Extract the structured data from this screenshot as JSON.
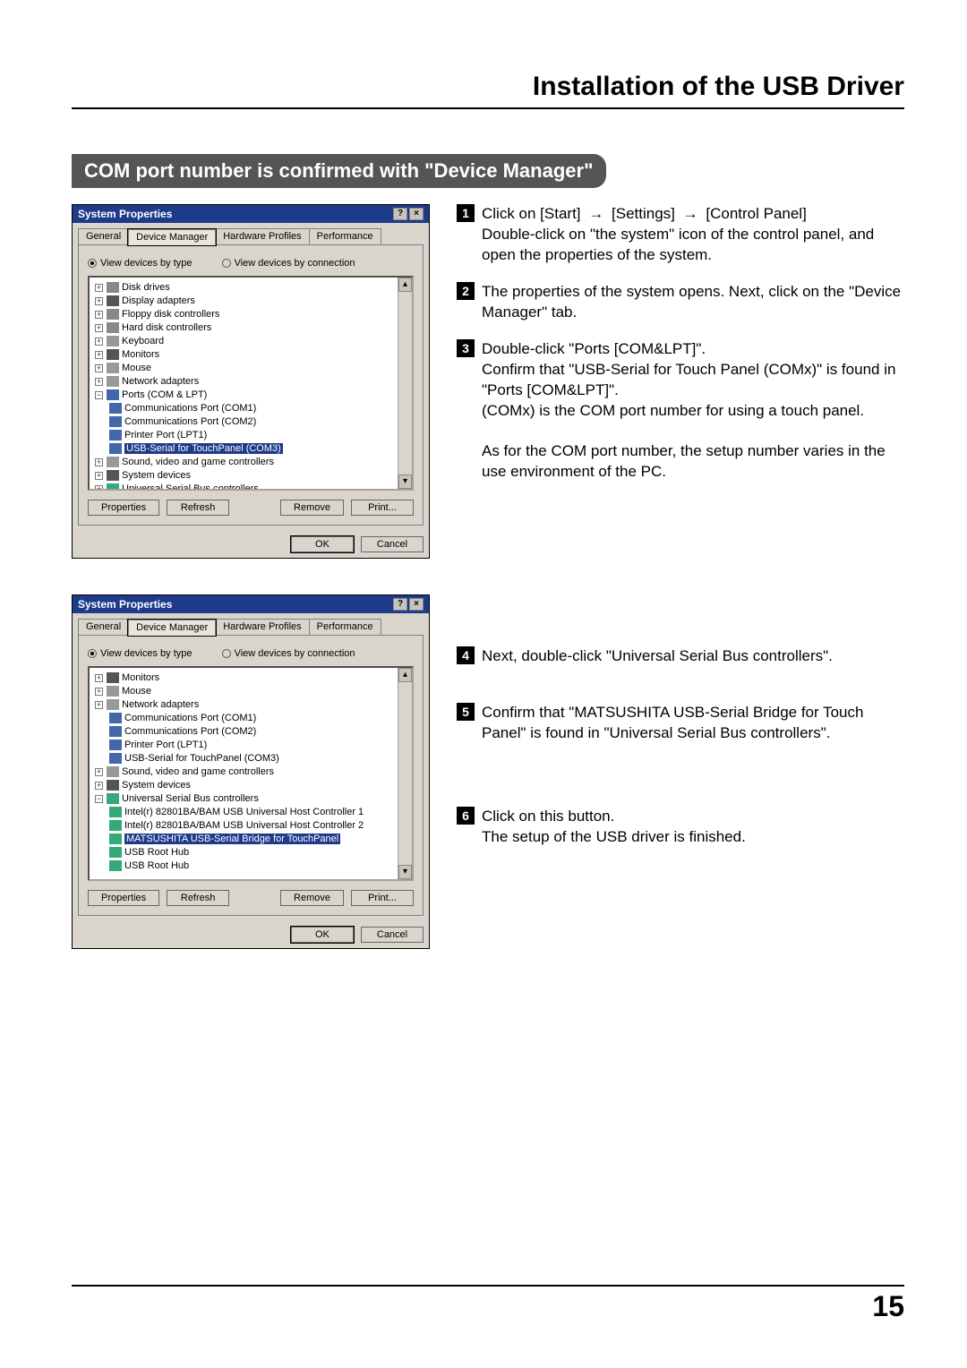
{
  "page_title": "Installation of the USB Driver",
  "page_number": "15",
  "section_banner": "COM port number is confirmed with \"Device Manager\"",
  "dialog1": {
    "title": "System Properties",
    "tabs": [
      "General",
      "Device Manager",
      "Hardware Profiles",
      "Performance"
    ],
    "active_tab": 1,
    "radio_type": "View devices by type",
    "radio_conn": "View devices by connection",
    "tree": {
      "disk": "Disk drives",
      "display": "Display adapters",
      "floppy": "Floppy disk controllers",
      "hdd": "Hard disk controllers",
      "keyboard": "Keyboard",
      "monitors": "Monitors",
      "mouse": "Mouse",
      "network": "Network adapters",
      "ports": "Ports (COM & LPT)",
      "com1": "Communications Port (COM1)",
      "com2": "Communications Port (COM2)",
      "lpt1": "Printer Port (LPT1)",
      "usbserial": "USB-Serial for TouchPanel (COM3)",
      "sound": "Sound, video and game controllers",
      "system": "System devices",
      "usbctl": "Universal Serial Bus controllers"
    },
    "btn_prop": "Properties",
    "btn_refresh": "Refresh",
    "btn_remove": "Remove",
    "btn_print": "Print...",
    "btn_ok": "OK",
    "btn_cancel": "Cancel"
  },
  "dialog2": {
    "title": "System Properties",
    "tabs": [
      "General",
      "Device Manager",
      "Hardware Profiles",
      "Performance"
    ],
    "active_tab": 1,
    "radio_type": "View devices by type",
    "radio_conn": "View devices by connection",
    "tree": {
      "monitors": "Monitors",
      "mouse": "Mouse",
      "network": "Network adapters",
      "com1": "Communications Port (COM1)",
      "com2": "Communications Port (COM2)",
      "lpt1": "Printer Port (LPT1)",
      "usbserial": "USB-Serial for TouchPanel (COM3)",
      "sound": "Sound, video and game controllers",
      "system": "System devices",
      "usbctl": "Universal Serial Bus controllers",
      "intel1": "Intel(r) 82801BA/BAM USB Universal Host Controller 1",
      "intel2": "Intel(r) 82801BA/BAM USB Universal Host Controller 2",
      "matsu": "MATSUSHITA USB-Serial Bridge for TouchPanel",
      "root1": "USB Root Hub",
      "root2": "USB Root Hub"
    },
    "btn_prop": "Properties",
    "btn_refresh": "Refresh",
    "btn_remove": "Remove",
    "btn_print": "Print...",
    "btn_ok": "OK",
    "btn_cancel": "Cancel"
  },
  "steps": {
    "s1a": "Click on [Start]",
    "s1b": "[Settings]",
    "s1c": "[Control Panel]",
    "s1d": "Double-click on \"the system\" icon of the control panel, and open the properties of the system.",
    "s2": "The properties of the system opens. Next, click on the \"Device Manager\" tab.",
    "s3a": "Double-click \"Ports [COM&LPT]\".",
    "s3b": "Confirm that \"USB-Serial for Touch Panel (COMx)\" is found in \"Ports [COM&LPT]\".",
    "s3c": "(COMx) is the COM port number for using a touch panel.",
    "s3d": "As for the COM port number, the setup number varies in the use environment of the PC.",
    "s4": "Next, double-click \"Universal Serial Bus controllers\".",
    "s5": "Confirm that \"MATSUSHITA USB-Serial Bridge for Touch Panel\" is found in \"Universal Serial Bus controllers\".",
    "s6a": "Click on this button.",
    "s6b": "The setup of the USB driver is finished."
  }
}
